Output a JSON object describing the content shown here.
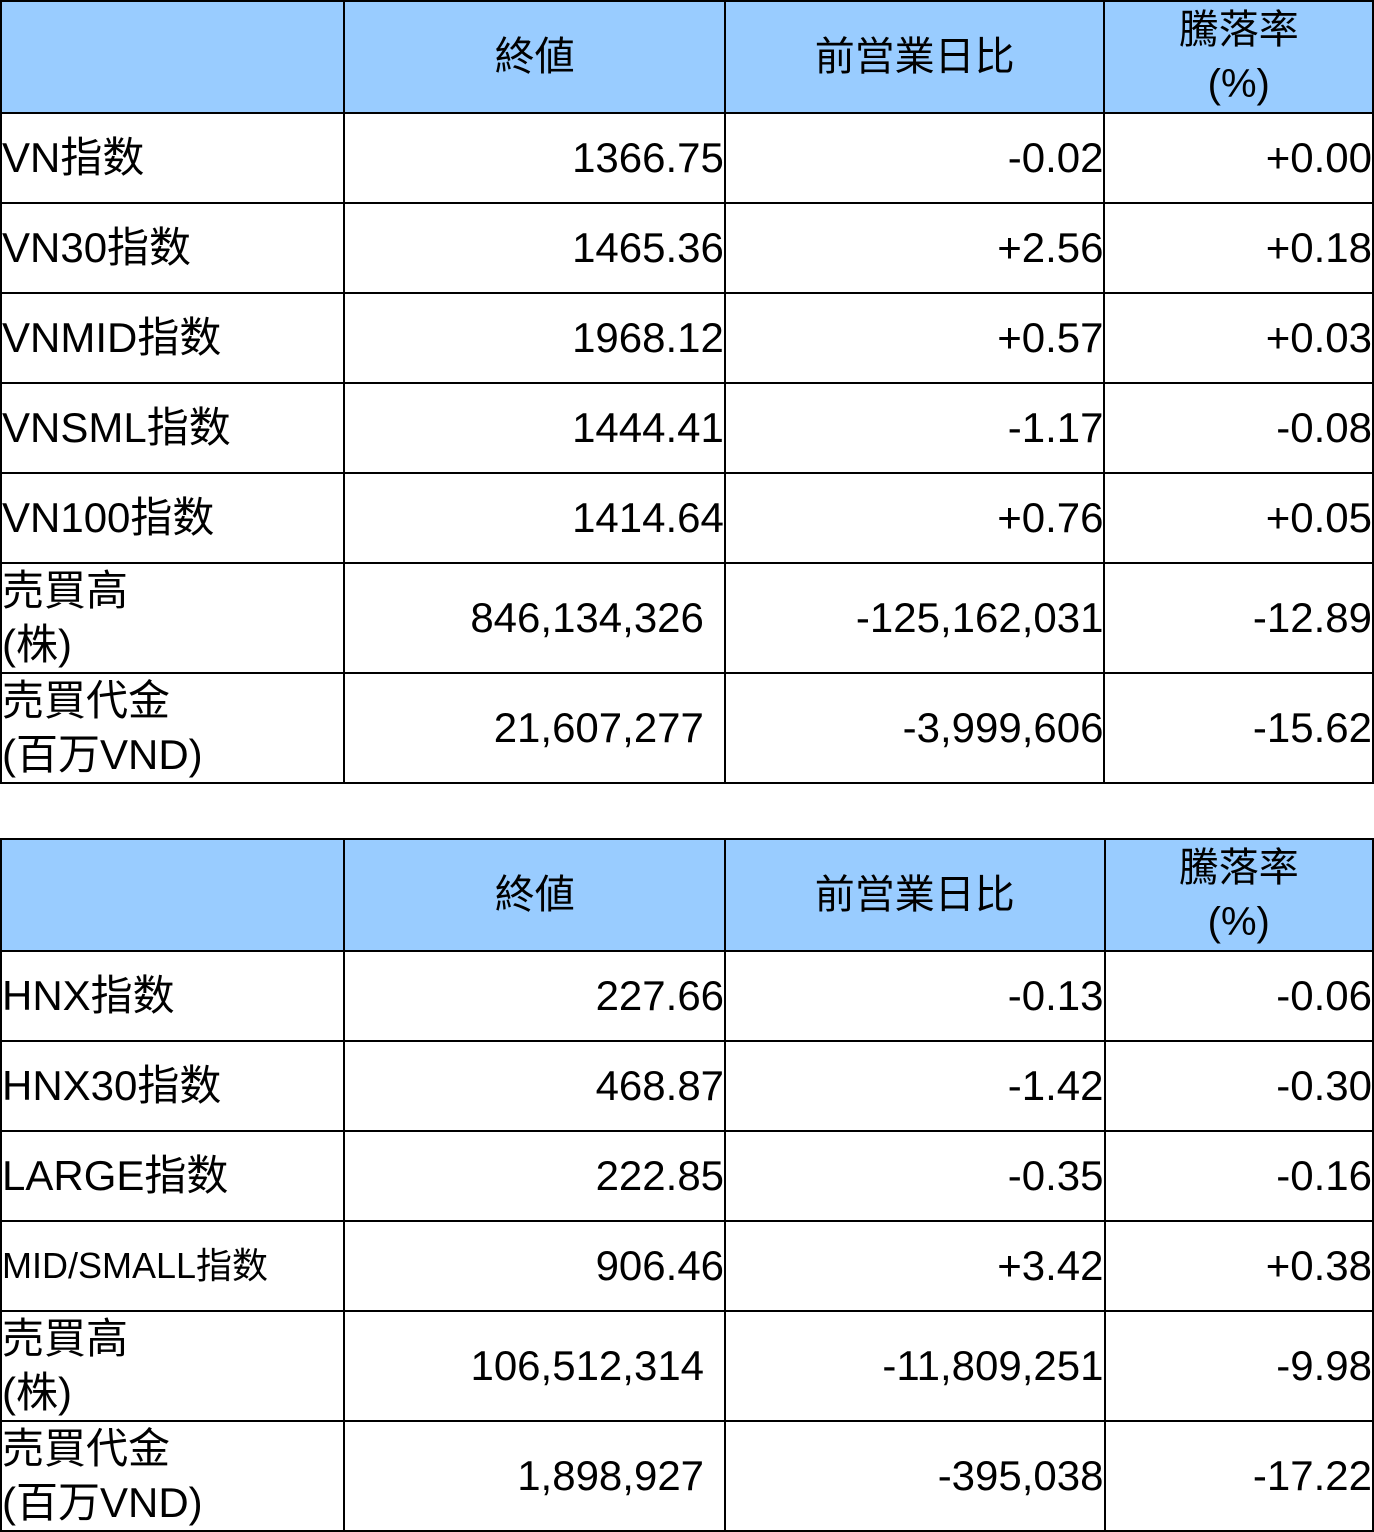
{
  "tables": [
    {
      "headers": [
        "",
        "終値",
        "前営業日比",
        "騰落率",
        "(%)"
      ],
      "rows": [
        {
          "label": "VN指数",
          "close": "1366.75",
          "change": "-0.02",
          "pct": "+0.00"
        },
        {
          "label": "VN30指数",
          "close": "1465.36",
          "change": "+2.56",
          "pct": "+0.18"
        },
        {
          "label": "VNMID指数",
          "close": "1968.12",
          "change": "+0.57",
          "pct": "+0.03"
        },
        {
          "label": "VNSML指数",
          "close": "1444.41",
          "change": "-1.17",
          "pct": "-0.08"
        },
        {
          "label": "VN100指数",
          "close": "1414.64",
          "change": "+0.76",
          "pct": "+0.05"
        },
        {
          "label": "売買高",
          "label2": "(株)",
          "close": "846,134,326",
          "change": "-125,162,031",
          "pct": "-12.89"
        },
        {
          "label": "売買代金",
          "label2": "(百万VND)",
          "close": "21,607,277",
          "change": "-3,999,606",
          "pct": "-15.62"
        }
      ]
    },
    {
      "headers": [
        "",
        "終値",
        "前営業日比",
        "騰落率",
        "(%)"
      ],
      "rows": [
        {
          "label": "HNX指数",
          "close": "227.66",
          "change": "-0.13",
          "pct": "-0.06"
        },
        {
          "label": "HNX30指数",
          "close": "468.87",
          "change": "-1.42",
          "pct": "-0.30"
        },
        {
          "label": "LARGE指数",
          "close": "222.85",
          "change": "-0.35",
          "pct": "-0.16"
        },
        {
          "label": "MID/SMALL指数",
          "close": "906.46",
          "change": "+3.42",
          "pct": "+0.38"
        },
        {
          "label": "売買高",
          "label2": "(株)",
          "close": "106,512,314",
          "change": "-11,809,251",
          "pct": "-9.98"
        },
        {
          "label": "売買代金",
          "label2": "(百万VND)",
          "close": "1,898,927",
          "change": "-395,038",
          "pct": "-17.22"
        }
      ]
    }
  ],
  "colors": {
    "header_bg": "#99ccff",
    "border": "#000000"
  }
}
